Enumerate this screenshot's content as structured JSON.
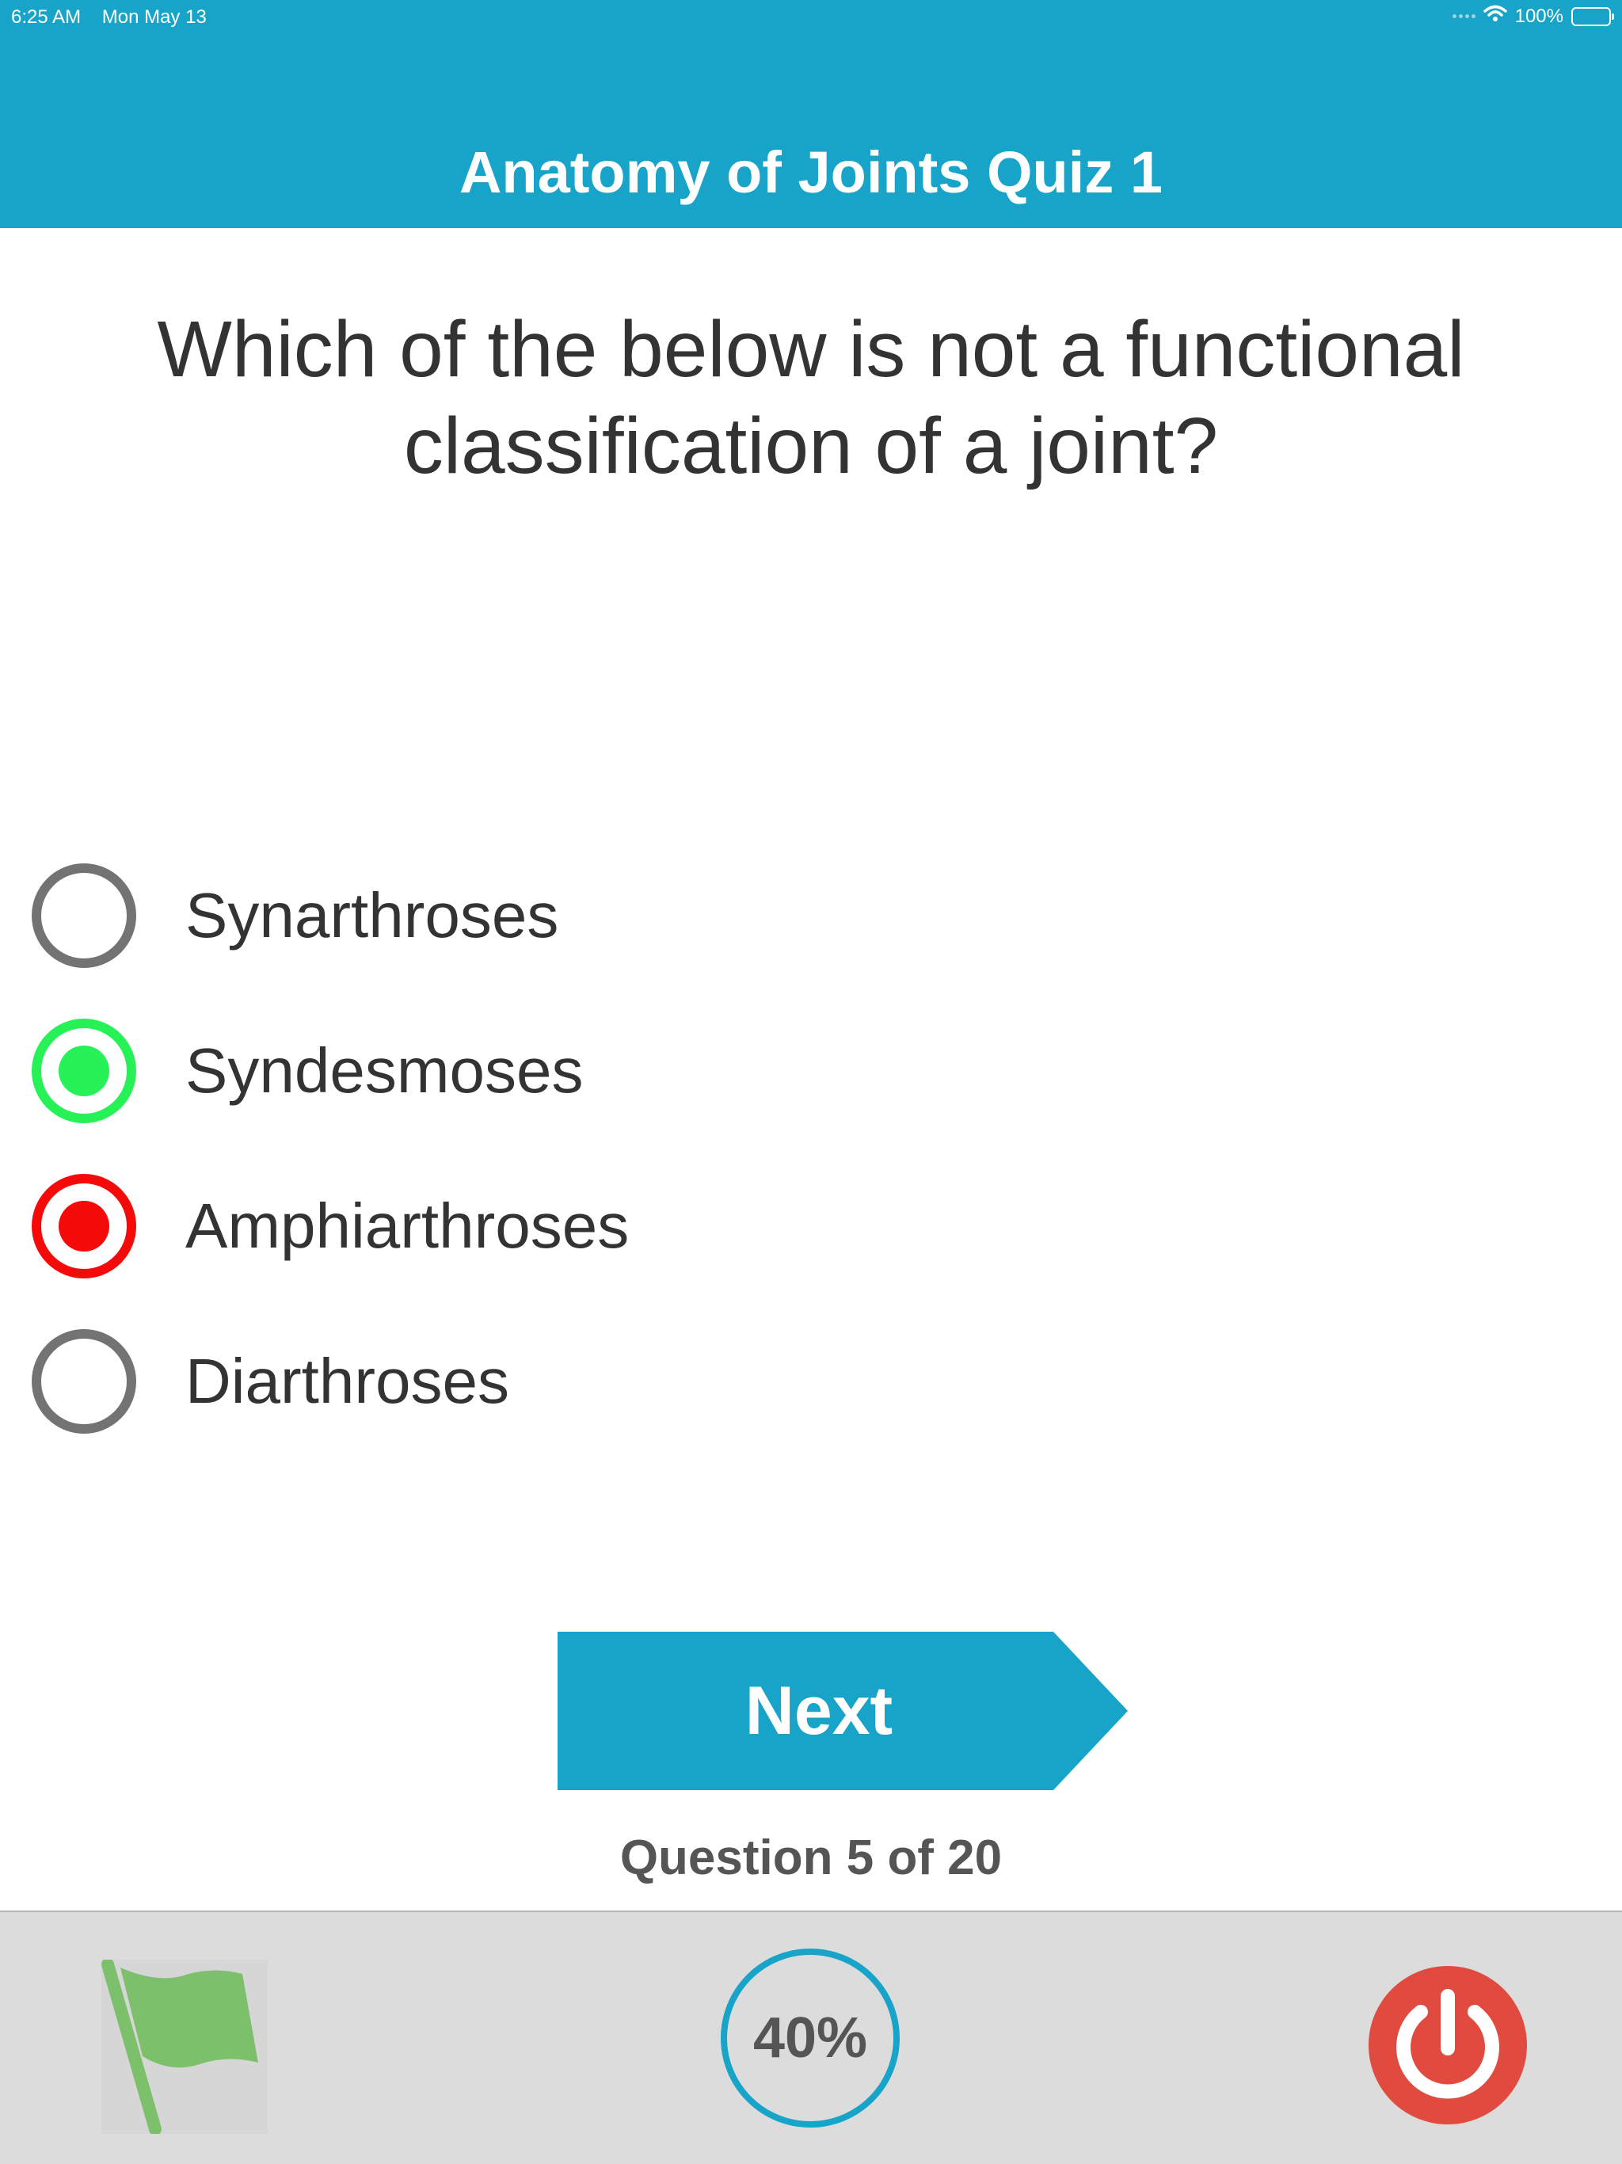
{
  "status_bar": {
    "time": "6:25 AM",
    "date": "Mon May 13",
    "battery": "100%"
  },
  "header": {
    "title": "Anatomy of Joints Quiz 1"
  },
  "question": {
    "text": "Which of the below is not a functional classification of a joint?"
  },
  "options": [
    {
      "label": "Synarthroses",
      "state": "unselected"
    },
    {
      "label": "Syndesmoses",
      "state": "correct"
    },
    {
      "label": "Amphiarthroses",
      "state": "incorrect"
    },
    {
      "label": "Diarthroses",
      "state": "unselected"
    }
  ],
  "next_button": {
    "label": "Next"
  },
  "progress": {
    "text": "Question 5 of 20"
  },
  "bottom_bar": {
    "percent": "40%",
    "flag_icon": "flag-icon",
    "power_icon": "power-icon"
  },
  "colors": {
    "accent": "#17a4c8",
    "correct": "#26f257",
    "incorrect": "#f50a0a",
    "flag": "#7cc06b",
    "power": "#e14b3f"
  }
}
